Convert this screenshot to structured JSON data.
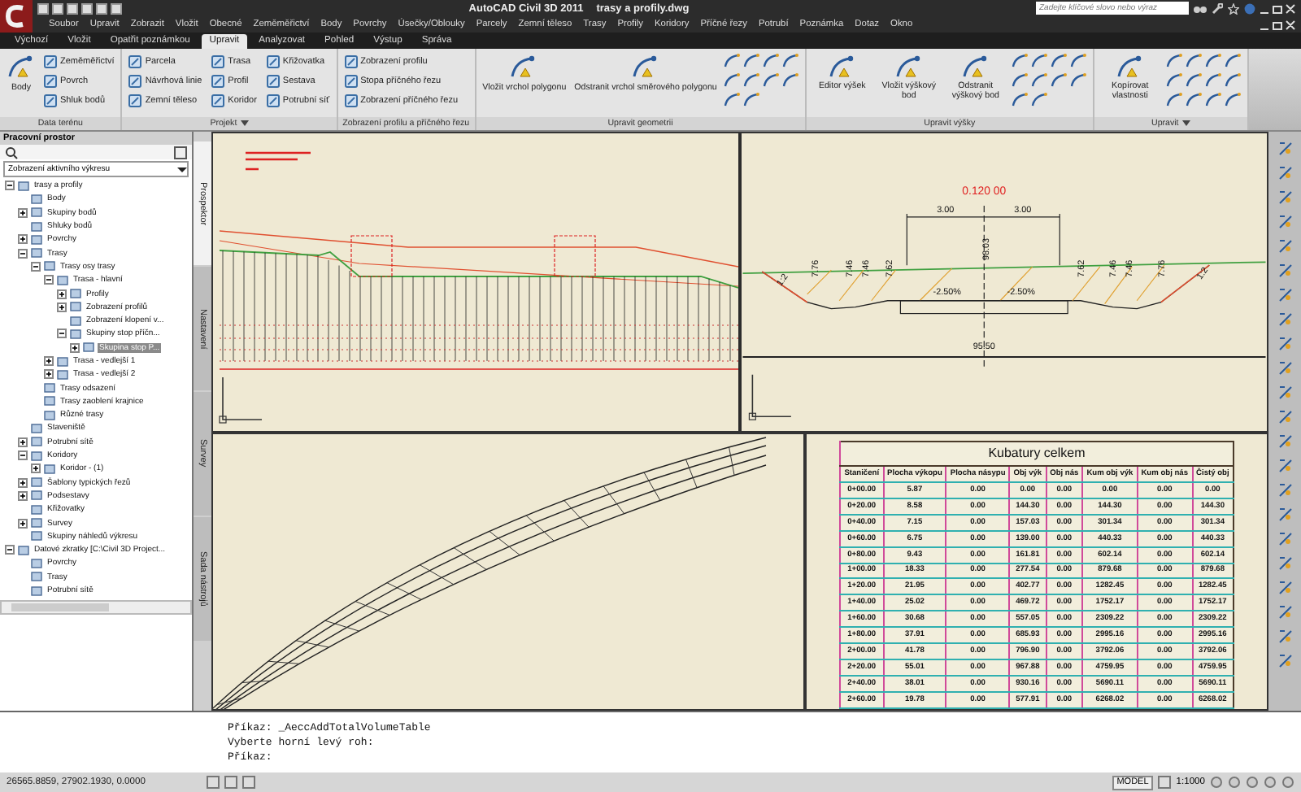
{
  "title_bar": {
    "app": "AutoCAD Civil 3D 2011",
    "file": "trasy a profily.dwg",
    "search": {
      "placeholder": "Zadejte klíčové slovo nebo výraz"
    }
  },
  "menu": [
    "Soubor",
    "Upravit",
    "Zobrazit",
    "Vložit",
    "Obecné",
    "Zeměměřictví",
    "Body",
    "Povrchy",
    "Úsečky/Oblouky",
    "Parcely",
    "Zemní těleso",
    "Trasy",
    "Profily",
    "Koridory",
    "Příčné řezy",
    "Potrubí",
    "Poznámka",
    "Dotaz",
    "Okno"
  ],
  "ribbon": {
    "tabs": [
      {
        "label": "Výchozí",
        "selected": false
      },
      {
        "label": "Vložit",
        "selected": false
      },
      {
        "label": "Opatřit poznámkou",
        "selected": false
      },
      {
        "label": "Upravit",
        "selected": true
      },
      {
        "label": "Analyzovat",
        "selected": false
      },
      {
        "label": "Pohled",
        "selected": false
      },
      {
        "label": "Výstup",
        "selected": false
      },
      {
        "label": "Správa",
        "selected": false
      }
    ],
    "panels": [
      {
        "title": "Data terénu",
        "large": [
          "Body"
        ],
        "small": [
          "Zeměměřictví",
          "Povrch",
          "Shluk bodů"
        ]
      },
      {
        "title": "Projekt",
        "menu": true,
        "small": [
          "Parcela",
          "Návrhová linie",
          "Zemní těleso",
          "Trasa",
          "Profil",
          "Koridor",
          "Křižovatka",
          "Sestava",
          "Potrubní síť"
        ]
      },
      {
        "title": "Zobrazení profilu a příčného řezu",
        "small": [
          "Zobrazení profilu",
          "Stopa příčného řezu",
          "Zobrazení příčného řezu"
        ]
      },
      {
        "title": "Upravit geometrii",
        "large": [
          "Vložit vrchol polygonu",
          "Odstranit vrchol směrového polygonu"
        ]
      },
      {
        "title": "Upravit výšky",
        "large": [
          "Editor výšek",
          "Vložit výškový bod",
          "Odstranit výškový bod"
        ]
      },
      {
        "title": "Upravit",
        "menu": true,
        "large": [
          "Kopírovat vlastnosti"
        ]
      }
    ]
  },
  "palette": {
    "title": "Pracovní prostor",
    "view": "Zobrazení aktivního výkresu",
    "tree": [
      {
        "label": "trasy a profily",
        "expanded": true,
        "selected": false,
        "children": [
          {
            "label": "Body",
            "selected": false
          },
          {
            "label": "Skupiny bodů",
            "expanded": false,
            "selected": false
          },
          {
            "label": "Shluky bodů",
            "selected": false
          },
          {
            "label": "Povrchy",
            "expanded": false,
            "selected": false
          },
          {
            "label": "Trasy",
            "expanded": true,
            "selected": false,
            "children": [
              {
                "label": "Trasy osy trasy",
                "expanded": true,
                "selected": false,
                "children": [
                  {
                    "label": "Trasa - hlavní",
                    "expanded": true,
                    "selected": false,
                    "children": [
                      {
                        "label": "Profily",
                        "expanded": false,
                        "selected": false
                      },
                      {
                        "label": "Zobrazení profilů",
                        "expanded": false,
                        "selected": false
                      },
                      {
                        "label": "Zobrazení klopení v...",
                        "selected": false
                      },
                      {
                        "label": "Skupiny stop příčn...",
                        "expanded": true,
                        "selected": false,
                        "children": [
                          {
                            "label": "Skupina stop P...",
                            "expanded": false,
                            "selected": true
                          }
                        ]
                      }
                    ]
                  },
                  {
                    "label": "Trasa - vedlejší 1",
                    "expanded": false,
                    "selected": false
                  },
                  {
                    "label": "Trasa - vedlejší 2",
                    "expanded": false,
                    "selected": false
                  }
                ]
              },
              {
                "label": "Trasy odsazení",
                "selected": false
              },
              {
                "label": "Trasy zaoblení krajnice",
                "selected": false
              },
              {
                "label": "Různé trasy",
                "selected": false
              }
            ]
          },
          {
            "label": "Staveniště",
            "selected": false
          },
          {
            "label": "Potrubní sítě",
            "expanded": false,
            "selected": false
          },
          {
            "label": "Koridory",
            "expanded": true,
            "selected": false,
            "children": [
              {
                "label": "Koridor - (1)",
                "expanded": false,
                "selected": false
              }
            ]
          },
          {
            "label": "Šablony typických řezů",
            "expanded": false,
            "selected": false
          },
          {
            "label": "Podsestavy",
            "expanded": false,
            "selected": false
          },
          {
            "label": "Křižovatky",
            "selected": false
          },
          {
            "label": "Survey",
            "expanded": false,
            "selected": false
          },
          {
            "label": "Skupiny náhledů výkresu",
            "selected": false
          }
        ]
      },
      {
        "label": "Datové zkratky [C:\\Civil 3D Project...",
        "expanded": true,
        "selected": false,
        "children": [
          {
            "label": "Povrchy",
            "selected": false
          },
          {
            "label": "Trasy",
            "selected": false
          },
          {
            "label": "Potrubní sítě",
            "selected": false
          }
        ]
      }
    ],
    "side_tabs": [
      {
        "label": "Prospektor",
        "selected": true
      },
      {
        "label": "Nastavení",
        "selected": false
      },
      {
        "label": "Survey",
        "selected": false
      },
      {
        "label": "Sada nástrojů",
        "selected": false
      }
    ]
  },
  "viewports": {
    "cross_section_labels": [
      "0.120 00",
      "3.00",
      "3.00",
      "98.03",
      "-2.50%",
      "-2.50%",
      "95.50",
      "1:2",
      "7.76",
      "7.46",
      "7.46",
      "7.62",
      "7.62",
      "7.46",
      "7.46",
      "7.76",
      "1:2"
    ],
    "table": {
      "title": "Kubatury celkem",
      "columns": [
        "Staničení",
        "Plocha výkopu",
        "Plocha násypu",
        "Obj výk",
        "Obj nás",
        "Kum obj výk",
        "Kum obj nás",
        "Čistý obj"
      ],
      "rows": [
        [
          "0+00.00",
          "5.87",
          "0.00",
          "0.00",
          "0.00",
          "0.00",
          "0.00",
          "0.00"
        ],
        [
          "0+20.00",
          "8.58",
          "0.00",
          "144.30",
          "0.00",
          "144.30",
          "0.00",
          "144.30"
        ],
        [
          "0+40.00",
          "7.15",
          "0.00",
          "157.03",
          "0.00",
          "301.34",
          "0.00",
          "301.34"
        ],
        [
          "0+60.00",
          "6.75",
          "0.00",
          "139.00",
          "0.00",
          "440.33",
          "0.00",
          "440.33"
        ],
        [
          "0+80.00",
          "9.43",
          "0.00",
          "161.81",
          "0.00",
          "602.14",
          "0.00",
          "602.14"
        ],
        [
          "1+00.00",
          "18.33",
          "0.00",
          "277.54",
          "0.00",
          "879.68",
          "0.00",
          "879.68"
        ],
        [
          "1+20.00",
          "21.95",
          "0.00",
          "402.77",
          "0.00",
          "1282.45",
          "0.00",
          "1282.45"
        ],
        [
          "1+40.00",
          "25.02",
          "0.00",
          "469.72",
          "0.00",
          "1752.17",
          "0.00",
          "1752.17"
        ],
        [
          "1+60.00",
          "30.68",
          "0.00",
          "557.05",
          "0.00",
          "2309.22",
          "0.00",
          "2309.22"
        ],
        [
          "1+80.00",
          "37.91",
          "0.00",
          "685.93",
          "0.00",
          "2995.16",
          "0.00",
          "2995.16"
        ],
        [
          "2+00.00",
          "41.78",
          "0.00",
          "796.90",
          "0.00",
          "3792.06",
          "0.00",
          "3792.06"
        ],
        [
          "2+20.00",
          "55.01",
          "0.00",
          "967.88",
          "0.00",
          "4759.95",
          "0.00",
          "4759.95"
        ],
        [
          "2+40.00",
          "38.01",
          "0.00",
          "930.16",
          "0.00",
          "5690.11",
          "0.00",
          "5690.11"
        ],
        [
          "2+60.00",
          "19.78",
          "0.00",
          "577.91",
          "0.00",
          "6268.02",
          "0.00",
          "6268.02"
        ]
      ]
    }
  },
  "command_line": [
    "Příkaz: _AeccAddTotalVolumeTable",
    "Vyberte horní levý roh:",
    "Příkaz:"
  ],
  "status_bar": {
    "coordinates": "26565.8859, 27902.1930, 0.0000",
    "model": "MODEL",
    "scale": "1:1000"
  }
}
